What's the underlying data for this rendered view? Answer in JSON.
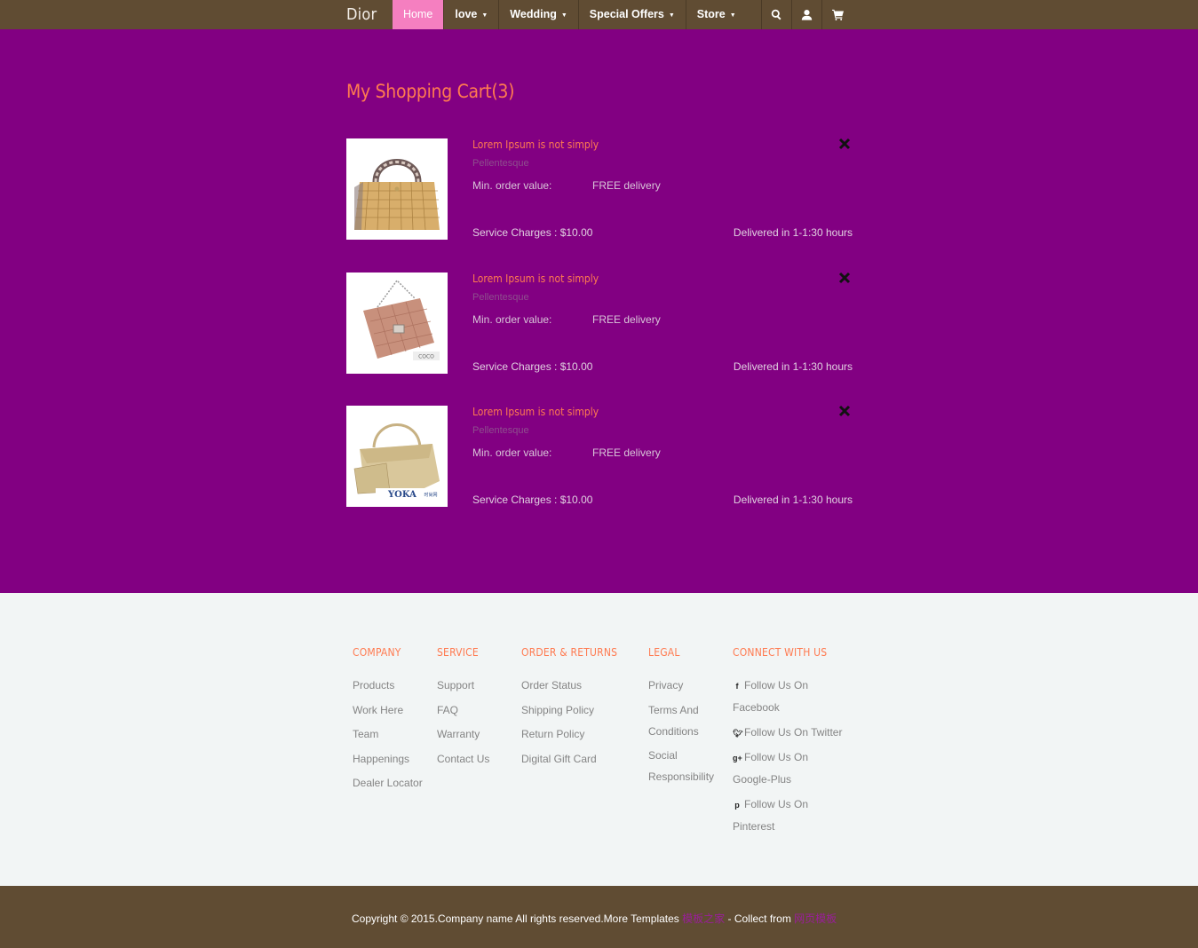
{
  "header": {
    "brand": "Dior",
    "nav": [
      {
        "label": "Home",
        "dropdown": false,
        "active": true
      },
      {
        "label": "love",
        "dropdown": true,
        "active": false
      },
      {
        "label": "Wedding",
        "dropdown": true,
        "active": false
      },
      {
        "label": "Special Offers",
        "dropdown": true,
        "active": false
      },
      {
        "label": "Store",
        "dropdown": true,
        "active": false
      }
    ],
    "icons": [
      "search-icon",
      "user-icon",
      "cart-icon"
    ]
  },
  "cart": {
    "title": "My Shopping Cart(3)",
    "items": [
      {
        "title": "Lorem Ipsum is not simply",
        "subtitle": "Pellentesque",
        "min_order_label": "Min. order value:",
        "delivery": "FREE delivery",
        "service_charges": "Service Charges : $10.00",
        "delivered": "Delivered in 1-1:30 hours",
        "image": "handbag-woven-tan"
      },
      {
        "title": "Lorem Ipsum is not simply",
        "subtitle": "Pellentesque",
        "min_order_label": "Min. order value:",
        "delivery": "FREE delivery",
        "service_charges": "Service Charges : $10.00",
        "delivered": "Delivered in 1-1:30 hours",
        "image": "handbag-quilted-pink"
      },
      {
        "title": "Lorem Ipsum is not simply",
        "subtitle": "Pellentesque",
        "min_order_label": "Min. order value:",
        "delivery": "FREE delivery",
        "service_charges": "Service Charges : $10.00",
        "delivered": "Delivered in 1-1:30 hours",
        "image": "handbag-gold"
      }
    ]
  },
  "footer": {
    "company": {
      "heading": "Company",
      "links": [
        "Products",
        "Work Here",
        "Team",
        "Happenings",
        "Dealer Locator"
      ]
    },
    "service": {
      "heading": "Service",
      "links": [
        "Support",
        "FAQ",
        "Warranty",
        "Contact Us"
      ]
    },
    "orders": {
      "heading": "Order & Returns",
      "links": [
        "Order Status",
        "Shipping Policy",
        "Return Policy",
        "Digital Gift Card"
      ]
    },
    "legal": {
      "heading": "Legal",
      "links": [
        "Privacy",
        "Terms And Conditions",
        "Social Responsibility"
      ]
    },
    "connect": {
      "heading": "Connect With Us",
      "links": [
        {
          "icon": "facebook-icon",
          "glyph": "f",
          "line1": "Follow Us On",
          "line2": "Facebook"
        },
        {
          "icon": "twitter-icon",
          "glyph": "t",
          "line1": "Follow Us On Twitter",
          "line2": ""
        },
        {
          "icon": "google-plus-icon",
          "glyph": "g+",
          "line1": "Follow Us On",
          "line2": "Google-Plus"
        },
        {
          "icon": "pinterest-icon",
          "glyph": "p",
          "line1": "Follow Us On",
          "line2": "Pinterest"
        }
      ]
    }
  },
  "copyright": {
    "text": "Copyright © 2015.Company name All rights reserved.More Templates ",
    "link1": "模板之家",
    "middle": " - Collect from ",
    "link2": "网页模板"
  },
  "colors": {
    "header_bg": "#604c33",
    "main_bg": "#820082",
    "accent": "#ff7a50",
    "active_nav": "#f57fc0",
    "footer_bg": "#f2f5f5"
  }
}
